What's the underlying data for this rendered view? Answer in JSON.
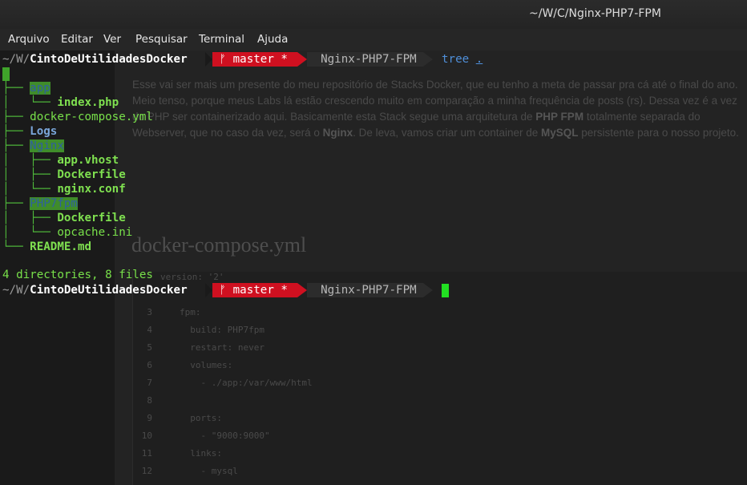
{
  "window": {
    "title": "~/W/C/Nginx-PHP7-FPM"
  },
  "menu": [
    "Arquivo",
    "Editar",
    "Ver",
    "Pesquisar",
    "Terminal",
    "Ajuda"
  ],
  "prompt": {
    "path_prefix": "~/W/",
    "path_bold": "CintoDeUtilidadesDocker",
    "branch_glyph": "ᚠ",
    "branch": "master *",
    "dir": "Nginx-PHP7-FPM",
    "command": "tree",
    "command_arg": "."
  },
  "tree_lines": [
    {
      "prefix": "├── ",
      "name": "app",
      "style": "dirhl"
    },
    {
      "prefix": "│   └── ",
      "name": "index.php",
      "style": "greenb"
    },
    {
      "prefix": "├── ",
      "name": "docker-compose.yml",
      "style": "green"
    },
    {
      "prefix": "├── ",
      "name": "Logs",
      "style": "logs"
    },
    {
      "prefix": "├── ",
      "name": "Nginx",
      "style": "dirhl"
    },
    {
      "prefix": "│   ├── ",
      "name": "app.vhost",
      "style": "greenb"
    },
    {
      "prefix": "│   ├── ",
      "name": "Dockerfile",
      "style": "greenb"
    },
    {
      "prefix": "│   └── ",
      "name": "nginx.conf",
      "style": "greenb"
    },
    {
      "prefix": "├── ",
      "name": "PHP7fpm",
      "style": "dirhl"
    },
    {
      "prefix": "│   ├── ",
      "name": "Dockerfile",
      "style": "greenb"
    },
    {
      "prefix": "│   └── ",
      "name": "opcache.ini",
      "style": "green"
    },
    {
      "prefix": "└── ",
      "name": "README.md",
      "style": "greenb"
    }
  ],
  "summary": "4 directories, 8 files",
  "background_page": {
    "paragraph_html": "Esse vai ser mais um presente do meu repositório de Stacks Docker, que eu tenho a meta de passar pra cá até o final do ano. Meio tenso, porque meus Labs lá estão crescendo muito em comparação a minha frequência de posts (rs). Dessa vez é a vez do PHP ser containerizado aqui. Basicamente esta Stack segue uma arquitetura de PHP FPM totalmente separada do Webserver, que no caso da vez, será o Nginx. De leva, vamos criar um container de MySQL persistente para o nosso projeto.",
    "heading": "docker-compose.yml",
    "code_lines": [
      {
        "num": "",
        "text": "version: '2'"
      },
      {
        "num": "3",
        "text": "fpm:"
      },
      {
        "num": "4",
        "text": "  build: PHP7fpm"
      },
      {
        "num": "5",
        "text": "  restart: never"
      },
      {
        "num": "6",
        "text": "  volumes:"
      },
      {
        "num": "7",
        "text": "    - ./app:/var/www/html"
      },
      {
        "num": "8",
        "text": ""
      },
      {
        "num": "9",
        "text": "  ports:"
      },
      {
        "num": "10",
        "text": "    - \"9000:9000\""
      },
      {
        "num": "11",
        "text": "  links:"
      },
      {
        "num": "12",
        "text": "    - mysql"
      }
    ]
  },
  "colors": {
    "git_segment": "#cf1020",
    "cursor": "#22e022",
    "file_green": "#78e04a",
    "dir_highlight": "#3f8c2a"
  }
}
